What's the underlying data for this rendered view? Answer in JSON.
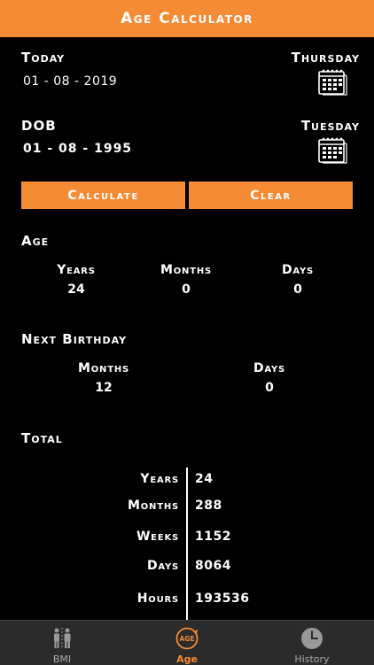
{
  "header": {
    "title": "Age Calculator"
  },
  "today": {
    "label": "Today",
    "date": "01 - 08 - 2019",
    "weekday": "Thursday"
  },
  "dob": {
    "label": "DOB",
    "date": "01 - 08 - 1995",
    "weekday": "Tuesday"
  },
  "buttons": {
    "calculate": "Calculate",
    "clear": "Clear"
  },
  "age": {
    "title": "Age",
    "columns": [
      {
        "label": "Years",
        "value": "24"
      },
      {
        "label": "Months",
        "value": "0"
      },
      {
        "label": "Days",
        "value": "0"
      }
    ]
  },
  "next_birthday": {
    "title": "Next Birthday",
    "columns": [
      {
        "label": "Months",
        "value": "12"
      },
      {
        "label": "Days",
        "value": "0"
      }
    ]
  },
  "total": {
    "title": "Total",
    "rows": [
      {
        "label": "Years",
        "value": "24"
      },
      {
        "label": "Months",
        "value": "288"
      },
      {
        "label": "Weeks",
        "value": "1152"
      },
      {
        "label": "Days",
        "value": "8064"
      },
      {
        "label": "Hours",
        "value": "193536"
      }
    ]
  },
  "tabs": [
    {
      "label": "BMI",
      "icon": "bmi-people-icon"
    },
    {
      "label": "Age",
      "icon": "age-icon",
      "icon_text": "AGE"
    },
    {
      "label": "History",
      "icon": "clock-icon"
    }
  ],
  "colors": {
    "accent": "#f58b35",
    "background": "#000000",
    "tabbar": "#2b2b2b"
  }
}
